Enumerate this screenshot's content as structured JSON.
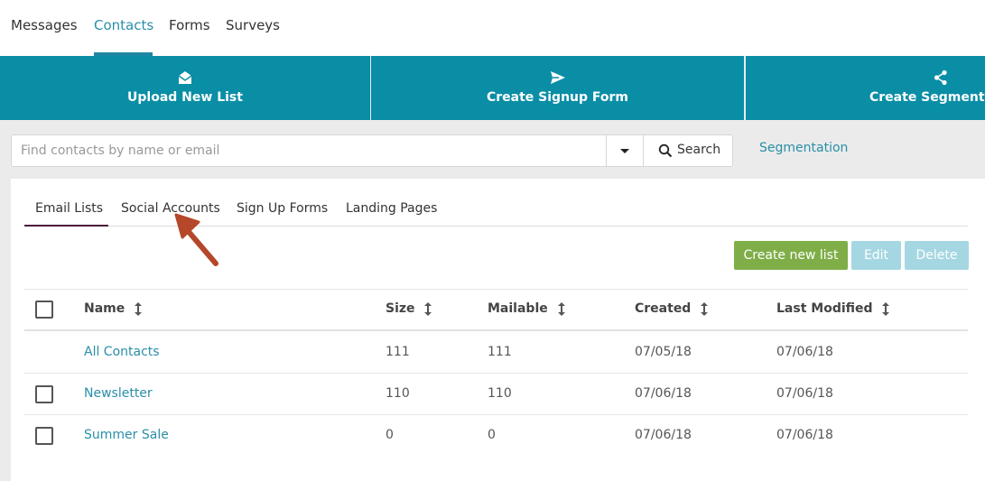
{
  "nav": {
    "items": [
      {
        "label": "Messages"
      },
      {
        "label": "Contacts",
        "active": true
      },
      {
        "label": "Forms"
      },
      {
        "label": "Surveys"
      }
    ]
  },
  "tiles": [
    {
      "label": "Upload New List",
      "icon": "envelope-open-icon"
    },
    {
      "label": "Create Signup Form",
      "icon": "paper-plane-icon"
    },
    {
      "label": "Create Segmentation",
      "icon": "share-icon"
    }
  ],
  "search": {
    "placeholder": "Find contacts by name or email",
    "value": "",
    "button_label": "Search"
  },
  "segmentation_link": "Segmentation",
  "tabs": [
    {
      "label": "Email Lists",
      "active": true
    },
    {
      "label": "Social Accounts"
    },
    {
      "label": "Sign Up Forms"
    },
    {
      "label": "Landing Pages"
    }
  ],
  "actions": {
    "create": "Create new list",
    "edit": "Edit",
    "delete": "Delete"
  },
  "table": {
    "columns": [
      "Name",
      "Size",
      "Mailable",
      "Created",
      "Last Modified"
    ],
    "rows": [
      {
        "name": "All Contacts",
        "size": "111",
        "mailable": "111",
        "created": "07/05/18",
        "modified": "07/06/18",
        "has_checkbox": false
      },
      {
        "name": "Newsletter",
        "size": "110",
        "mailable": "110",
        "created": "07/06/18",
        "modified": "07/06/18",
        "has_checkbox": true
      },
      {
        "name": "Summer Sale",
        "size": "0",
        "mailable": "0",
        "created": "07/06/18",
        "modified": "07/06/18",
        "has_checkbox": true
      }
    ]
  },
  "colors": {
    "accent": "#0a8ea6",
    "link": "#2a8fa8",
    "create_button": "#7fae48",
    "disabled_button": "#a5d7e2",
    "annotation_arrow": "#b5472a"
  }
}
